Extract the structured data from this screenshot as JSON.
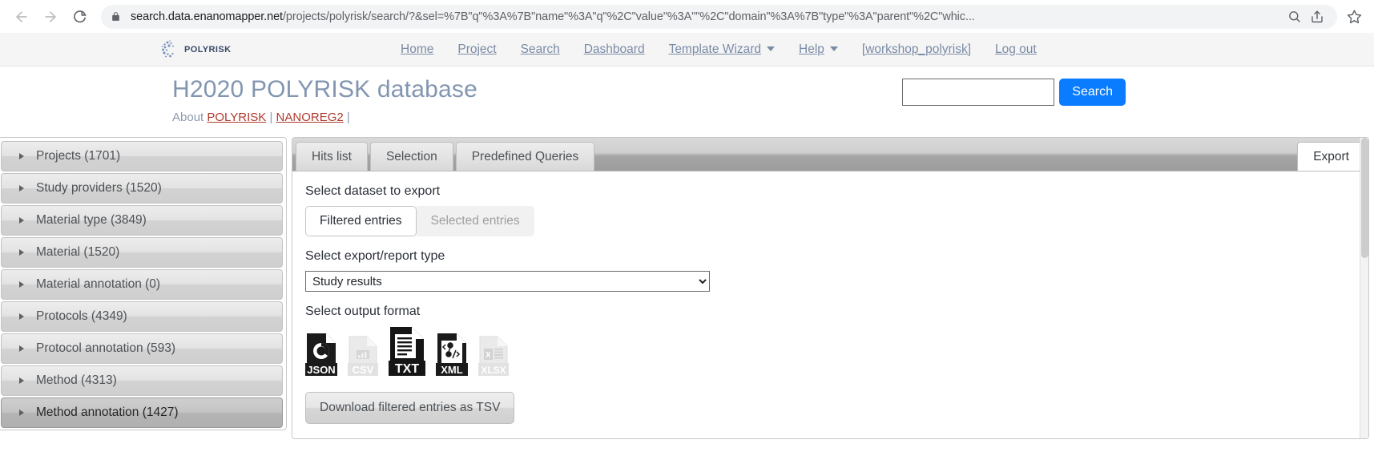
{
  "browser": {
    "url_host": "search.data.enanomapper.net",
    "url_path": "/projects/polyrisk/search/?&sel=%7B\"q\"%3A%7B\"name\"%3A\"q\"%2C\"value\"%3A\"\"%2C\"domain\"%3A%7B\"type\"%3A\"parent\"%2C\"whic...",
    "back_icon": "back-arrow-icon",
    "forward_icon": "forward-arrow-icon",
    "reload_icon": "reload-icon",
    "lock_icon": "lock-icon",
    "zoom_icon": "search-magnifier-icon",
    "share_icon": "share-icon",
    "bookmark_icon": "star-icon"
  },
  "topnav": {
    "brand": "POLYRISK",
    "links": [
      {
        "label": "Home",
        "dropdown": false
      },
      {
        "label": "Project",
        "dropdown": false
      },
      {
        "label": "Search",
        "dropdown": false
      },
      {
        "label": "Dashboard",
        "dropdown": false
      },
      {
        "label": "Template Wizard",
        "dropdown": true
      },
      {
        "label": "Help",
        "dropdown": true
      },
      {
        "label": "[workshop_polyrisk]",
        "dropdown": false
      },
      {
        "label": "Log out",
        "dropdown": false
      }
    ]
  },
  "header": {
    "title": "H2020 POLYRISK database",
    "about_prefix": "About",
    "about_links": [
      "POLYRISK",
      "NANOREG2"
    ],
    "separator": "|",
    "search_value": "",
    "search_placeholder": "",
    "search_button": "Search"
  },
  "sidebar": {
    "facets": [
      {
        "label": "Projects (1701)",
        "active": false
      },
      {
        "label": "Study providers (1520)",
        "active": false
      },
      {
        "label": "Material type (3849)",
        "active": false
      },
      {
        "label": "Material (1520)",
        "active": false
      },
      {
        "label": "Material annotation (0)",
        "active": false
      },
      {
        "label": "Protocols (4349)",
        "active": false
      },
      {
        "label": "Protocol annotation (593)",
        "active": false
      },
      {
        "label": "Method (4313)",
        "active": false
      },
      {
        "label": "Method annotation (1427)",
        "active": true
      }
    ]
  },
  "tabs": [
    {
      "label": "Hits list",
      "active": false
    },
    {
      "label": "Selection",
      "active": false
    },
    {
      "label": "Predefined Queries",
      "active": false
    },
    {
      "label": "Export",
      "active": true
    }
  ],
  "export_panel": {
    "dataset_label": "Select dataset to export",
    "dataset_options": [
      {
        "label": "Filtered entries",
        "selected": true,
        "disabled": false
      },
      {
        "label": "Selected entries",
        "selected": false,
        "disabled": true
      }
    ],
    "report_type_label": "Select export/report type",
    "report_type_value": "Study results",
    "report_type_options": [
      "Study results"
    ],
    "output_format_label": "Select output format",
    "formats": [
      {
        "name": "json-format-icon",
        "label": "JSON",
        "enabled": true,
        "selected": false
      },
      {
        "name": "csv-format-icon",
        "label": "CSV",
        "enabled": false,
        "selected": false
      },
      {
        "name": "txt-format-icon",
        "label": "TXT",
        "enabled": true,
        "selected": true
      },
      {
        "name": "xml-format-icon",
        "label": "XML",
        "enabled": true,
        "selected": false
      },
      {
        "name": "xlsx-format-icon",
        "label": "XLSX",
        "enabled": false,
        "selected": false
      }
    ],
    "download_button": "Download filtered entries as TSV"
  },
  "colors": {
    "accent_blue": "#0a7cff",
    "title_blue_grey": "#8296b1",
    "link_red": "#b03a2e",
    "nav_link": "#7a8ba6"
  }
}
